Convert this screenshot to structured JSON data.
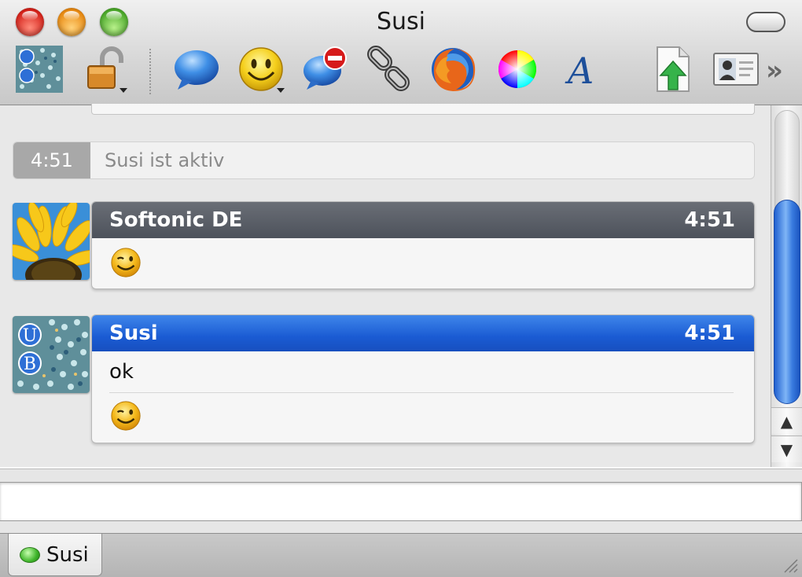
{
  "window": {
    "title": "Susi"
  },
  "toolbar": {
    "items": [
      {
        "icon": "user-avatar-icon"
      },
      {
        "icon": "padlock-open-icon",
        "has_menu": true
      },
      {
        "icon": "speech-bubble-icon"
      },
      {
        "icon": "smiley-face-icon",
        "has_menu": true
      },
      {
        "icon": "block-contact-icon"
      },
      {
        "icon": "chain-link-icon"
      },
      {
        "icon": "firefox-browser-icon"
      },
      {
        "icon": "color-wheel-icon"
      },
      {
        "icon": "font-italic-a-icon"
      },
      {
        "icon": "file-upload-icon"
      },
      {
        "icon": "contact-card-icon"
      },
      {
        "icon": "overflow-chevron-icon"
      }
    ],
    "overflow_glyph": "»"
  },
  "chat": {
    "status": {
      "time": "4:51",
      "text": "Susi ist aktiv"
    },
    "messages": [
      {
        "sender": "Softonic DE",
        "time": "4:51",
        "avatar": "sunflower-avatar",
        "header_color": "#4f545d",
        "lines": [],
        "emoticon": "wink-smiley-icon"
      },
      {
        "sender": "Susi",
        "time": "4:51",
        "avatar": "user-pattern-avatar",
        "header_color": "#1a5bd3",
        "lines": [
          "ok"
        ],
        "emoticon": "wink-smiley-icon"
      }
    ],
    "avatar_letters": {
      "u": "U",
      "b": "B"
    }
  },
  "scrollbar": {
    "up": "▲",
    "down": "▼"
  },
  "input": {
    "value": ""
  },
  "tabs": [
    {
      "label": "Susi",
      "status_color": "#3fb52a"
    }
  ],
  "colors": {
    "accent_blue": "#1a5bd3",
    "header_gray": "#4f545d",
    "status_gray": "#a8a8a8"
  }
}
